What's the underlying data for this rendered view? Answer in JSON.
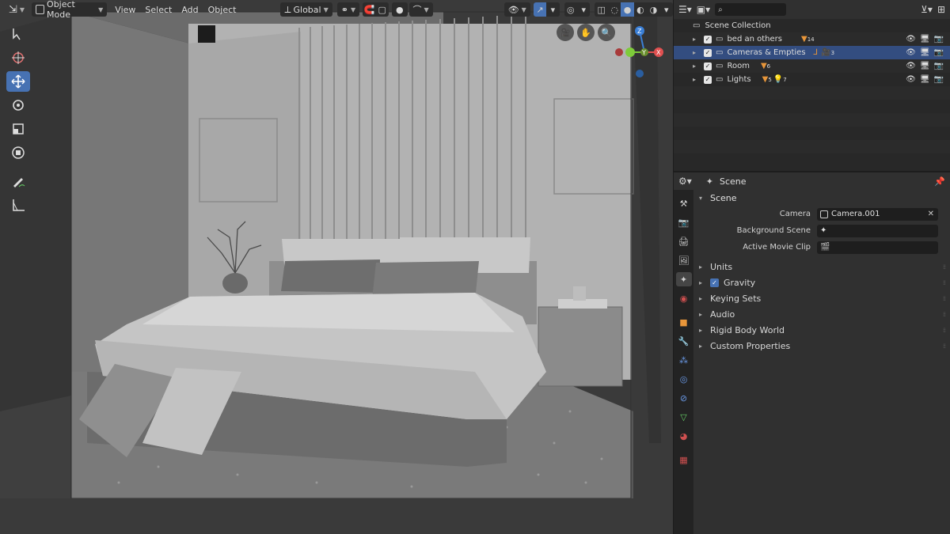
{
  "viewport": {
    "mode": "Object Mode",
    "menus": [
      "View",
      "Select",
      "Add",
      "Object"
    ],
    "orientation": "Global",
    "gizmo_axes": {
      "x": "X",
      "y": "Y",
      "z": "Z"
    }
  },
  "toolbar": {
    "tools": [
      "select-box",
      "cursor",
      "move",
      "rotate",
      "scale",
      "transform",
      "annotate",
      "measure"
    ],
    "active": "move"
  },
  "outliner": {
    "header": {
      "search_placeholder": ""
    },
    "root": "Scene Collection",
    "rows": [
      {
        "label": "bed an others",
        "badge": "14",
        "selected": false
      },
      {
        "label": "Cameras & Empties",
        "badge": "3",
        "selected": true
      },
      {
        "label": "Room",
        "badge": "6",
        "selected": false
      },
      {
        "label": "Lights",
        "badge": "5",
        "badge2": "7",
        "selected": false
      }
    ]
  },
  "properties": {
    "context": "Scene",
    "panel": "Scene",
    "fields": [
      {
        "label": "Camera",
        "value": "Camera.001"
      },
      {
        "label": "Background Scene",
        "value": ""
      },
      {
        "label": "Active Movie Clip",
        "value": ""
      }
    ],
    "subpanels": [
      "Units",
      "Gravity",
      "Keying Sets",
      "Audio",
      "Rigid Body World",
      "Custom Properties"
    ],
    "gravity_checked": true
  },
  "colors": {
    "accent": "#4772b3",
    "selected_row": "#334d80",
    "axis_x": "#e05050",
    "axis_y": "#7ecb3a",
    "axis_z": "#3a7fd6",
    "collection_orange": "#e8963a"
  }
}
